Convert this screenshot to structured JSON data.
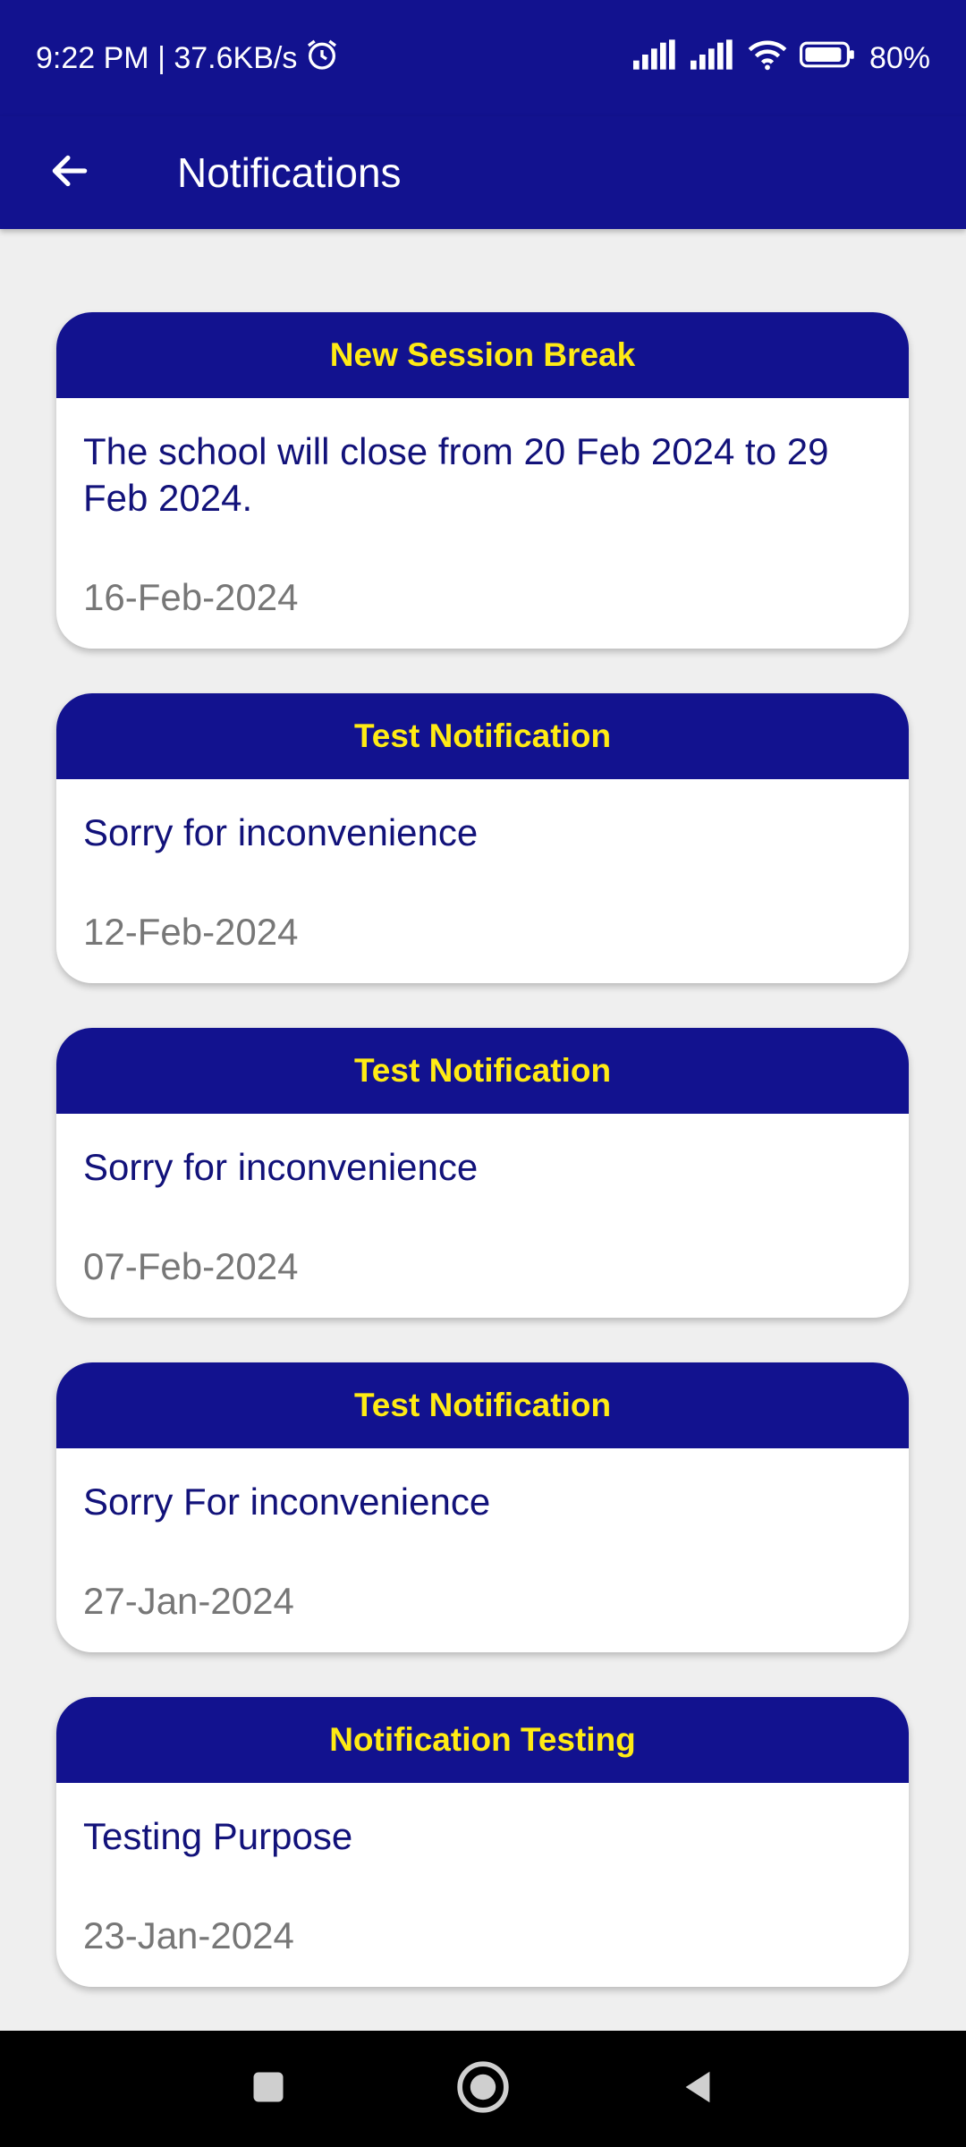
{
  "status_bar": {
    "time_speed": "9:22 PM | 37.6KB/s",
    "battery": "80%"
  },
  "app_bar": {
    "title": "Notifications"
  },
  "notifications": [
    {
      "title": "New Session Break",
      "message": "The school will close from 20 Feb 2024 to 29 Feb 2024.",
      "date": "16-Feb-2024"
    },
    {
      "title": "Test Notification",
      "message": "Sorry for inconvenience",
      "date": "12-Feb-2024"
    },
    {
      "title": "Test Notification",
      "message": "Sorry for inconvenience",
      "date": "07-Feb-2024"
    },
    {
      "title": "Test Notification",
      "message": "Sorry For inconvenience",
      "date": "27-Jan-2024"
    },
    {
      "title": "Notification Testing",
      "message": "Testing Purpose",
      "date": "23-Jan-2024"
    }
  ],
  "colors": {
    "primary": "#12128f",
    "header_text": "#ffeb14",
    "message_text": "#12127a",
    "date_text": "#777777",
    "background": "#efefef"
  }
}
